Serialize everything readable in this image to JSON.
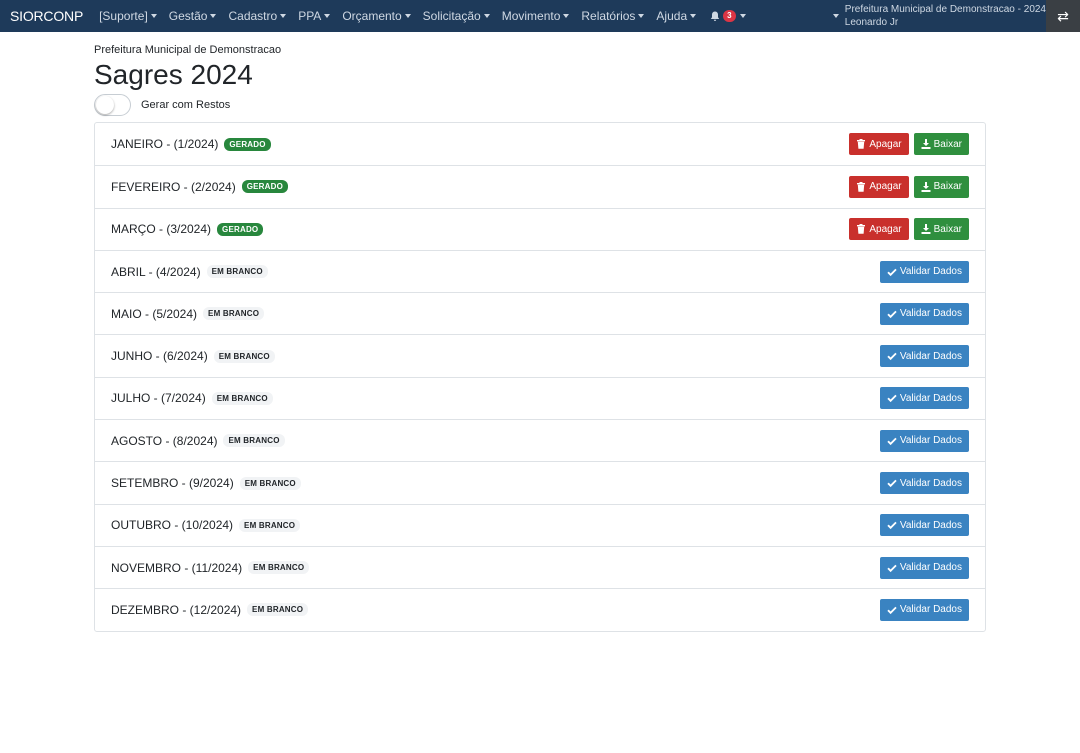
{
  "navbar": {
    "brand": "SIORCONP",
    "menus": [
      "[Suporte]",
      "Gestão",
      "Cadastro",
      "PPA",
      "Orçamento",
      "Solicitação",
      "Movimento",
      "Relatórios",
      "Ajuda"
    ],
    "notification_count": "3",
    "org_name": "Prefeitura Municipal de Demonstracao - 2024",
    "user_name": "Leonardo Jr",
    "swap_icon": "⇄"
  },
  "page": {
    "org": "Prefeitura Municipal de Demonstracao",
    "title": "Sagres 2024",
    "toggle_label": "Gerar com Restos"
  },
  "labels": {
    "delete": "Apagar",
    "download": "Baixar",
    "validate": "Validar Dados"
  },
  "months": [
    {
      "label": "JANEIRO - (1/2024)",
      "status": "GERADO"
    },
    {
      "label": "FEVEREIRO - (2/2024)",
      "status": "GERADO"
    },
    {
      "label": "MARÇO - (3/2024)",
      "status": "GERADO"
    },
    {
      "label": "ABRIL - (4/2024)",
      "status": "EM BRANCO"
    },
    {
      "label": "MAIO - (5/2024)",
      "status": "EM BRANCO"
    },
    {
      "label": "JUNHO - (6/2024)",
      "status": "EM BRANCO"
    },
    {
      "label": "JULHO - (7/2024)",
      "status": "EM BRANCO"
    },
    {
      "label": "AGOSTO - (8/2024)",
      "status": "EM BRANCO"
    },
    {
      "label": "SETEMBRO - (9/2024)",
      "status": "EM BRANCO"
    },
    {
      "label": "OUTUBRO - (10/2024)",
      "status": "EM BRANCO"
    },
    {
      "label": "NOVEMBRO - (11/2024)",
      "status": "EM BRANCO"
    },
    {
      "label": "DEZEMBRO - (12/2024)",
      "status": "EM BRANCO"
    }
  ],
  "colors": {
    "navbar": "#1e3a5a",
    "generated": "#28873d",
    "delete": "#c9302c",
    "download": "#2f8f3e",
    "validate": "#3a83c1"
  }
}
